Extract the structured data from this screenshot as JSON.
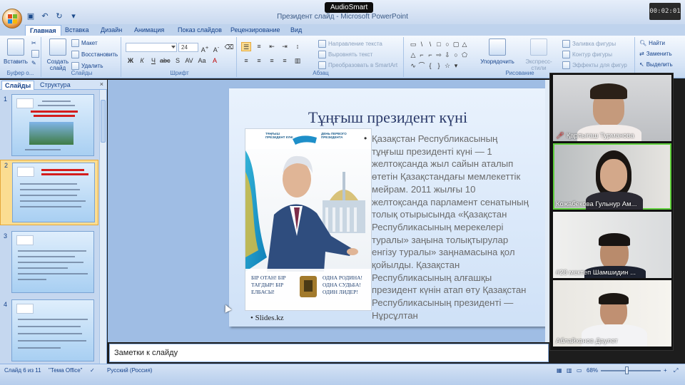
{
  "recorder": {
    "badge": "AudioSmart",
    "timer": "00:02:01"
  },
  "window": {
    "title": "Президент слайд - Microsoft PowerPoint"
  },
  "ribbon": {
    "tabs": [
      "Главная",
      "Вставка",
      "Дизайн",
      "Анимация",
      "Показ слайдов",
      "Рецензирование",
      "Вид"
    ],
    "active_tab": "Главная",
    "clipboard": {
      "paste": "Вставить",
      "label": "Буфер о..."
    },
    "slides": {
      "create": "Создать слайд",
      "layout": "Макет",
      "reset": "Восстановить",
      "delete": "Удалить",
      "label": "Слайды"
    },
    "font": {
      "size": "24",
      "label": "Шрифт"
    },
    "paragraph": {
      "text_direction": "Направление текста",
      "align_text": "Выровнять текст",
      "smartart": "Преобразовать в SmartArt",
      "label": "Абзац"
    },
    "drawing": {
      "arrange": "Упорядочить",
      "quick_styles": "Экспресс-стили",
      "shape_fill": "Заливка фигуры",
      "shape_outline": "Контур фигуры",
      "shape_effects": "Эффекты для фигур",
      "label": "Рисование"
    },
    "editing": {
      "find": "Найти",
      "replace": "Заменить",
      "select": "Выделить"
    }
  },
  "left_panel": {
    "tabs": [
      "Слайды",
      "Структура"
    ],
    "thumbnails": [
      {
        "num": "1"
      },
      {
        "num": "2"
      },
      {
        "num": "3"
      },
      {
        "num": "4"
      }
    ]
  },
  "slide": {
    "title": "Тұңғыш президент күні",
    "body": "Қазақстан Республикасының тұңғыш президенті күні — 1 желтоқсанда жыл сайын аталып өтетін Қазақстандағы мемлекеттік мейрам. 2011 жылғы 10 желтоқсанда парламент сенатының толық отырысында «Қазақстан Республикасының мерекелері туралы» заңына толықтырулар енгізу туралы» заңнамасына қол қойылды. Қазақстан Республикасының алғашқы президент күнін атап өту Қазақстан Республикасының президенті — Нұрсұлтан",
    "credit": "Slides.kz",
    "picture": {
      "header_left": "ТҰҢҒЫШ ПРЕЗИДЕНТ КҮНІ",
      "header_right": "ДЕНЬ ПЕРВОГО ПРЕЗИДЕНТА",
      "caption_left": "БІР ОТАН! БІР ТАҒДЫР! БІР ЕЛБАСЫ!",
      "caption_right": "ОДНА РОДИНА! ОДНА СУДЬБА! ОДИН ЛИДЕР!"
    }
  },
  "notes": {
    "placeholder": "Заметки к слайду"
  },
  "status": {
    "slide_pos": "Слайд 6 из 11",
    "theme": "\"Тема Office\"",
    "language": "Русский (Россия)",
    "zoom": "68%"
  },
  "participants": [
    {
      "name": "Қарлығаш Турманова"
    },
    {
      "name": "Кожабекова Гульнур Ам..."
    },
    {
      "name": "#28 мектеп Шамшидин ..."
    },
    {
      "name": "Аблайханов Даулет"
    }
  ],
  "colors": {
    "ribbon_bg": "#d6e4f6",
    "accent": "#15428b",
    "selected_slide": "#fbdd92",
    "speaking": "#5fcf3c"
  }
}
